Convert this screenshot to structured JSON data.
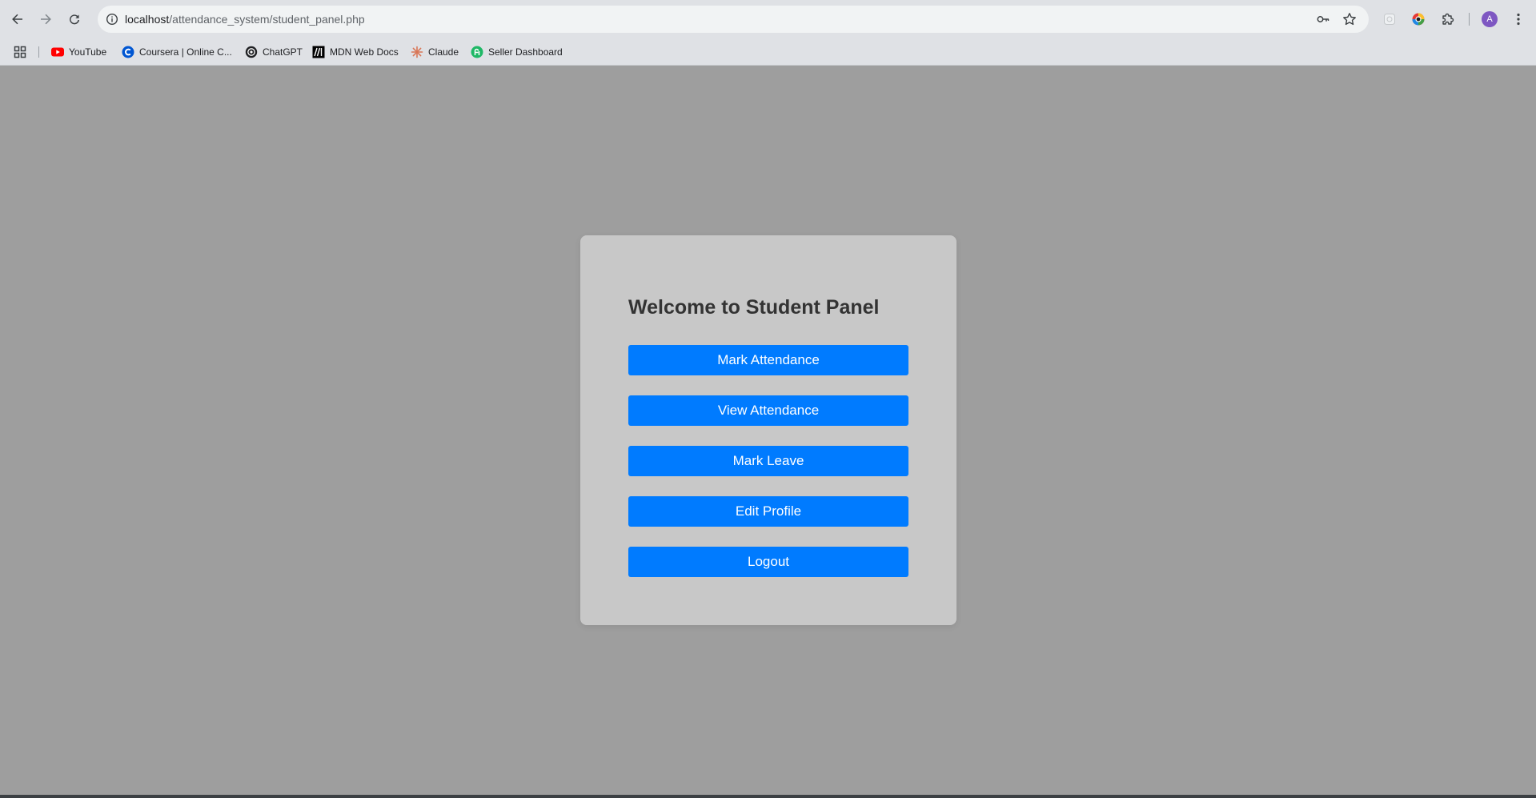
{
  "browser": {
    "url_host": "localhost",
    "url_path": "/attendance_system/student_panel.php",
    "profile_initial": "A"
  },
  "bookmarks": [
    {
      "label": "YouTube",
      "icon": "youtube-icon",
      "color": "#ff0000"
    },
    {
      "label": "Coursera | Online C...",
      "icon": "coursera-icon",
      "color": "#0056d2"
    },
    {
      "label": "ChatGPT",
      "icon": "chatgpt-icon",
      "color": "#202124"
    },
    {
      "label": "MDN Web Docs",
      "icon": "mdn-icon",
      "color": "#000000"
    },
    {
      "label": "Claude",
      "icon": "claude-icon",
      "color": "#d97757"
    },
    {
      "label": "Seller Dashboard",
      "icon": "seller-dashboard-icon",
      "color": "#1fb866"
    }
  ],
  "panel": {
    "title": "Welcome to Student Panel",
    "buttons": [
      {
        "label": "Mark Attendance"
      },
      {
        "label": "View Attendance"
      },
      {
        "label": "Mark Leave"
      },
      {
        "label": "Edit Profile"
      },
      {
        "label": "Logout"
      }
    ]
  },
  "colors": {
    "page_background": "#9e9e9e",
    "panel_background": "#c8c8c8",
    "button_primary": "#007bff",
    "title_text": "#333333"
  }
}
